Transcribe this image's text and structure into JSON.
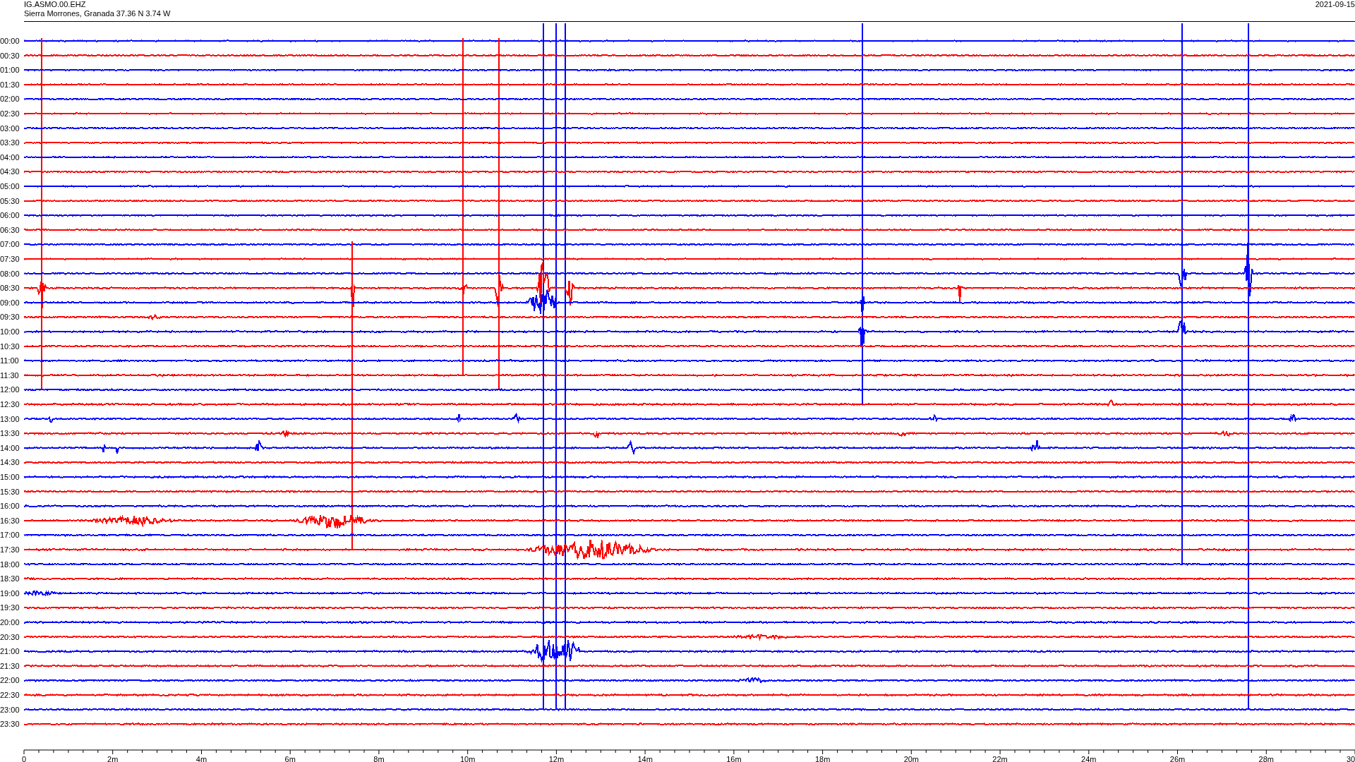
{
  "header": {
    "station": "IG.ASMO.00.EHZ",
    "location": "Sierra Morrones, Granada  37.36 N 3.74 W",
    "date": "2021-09-15"
  },
  "rows": [
    {
      "time": "00:00",
      "color": "#0000ff"
    },
    {
      "time": "00:30",
      "color": "#ff0000"
    },
    {
      "time": "01:00",
      "color": "#0000ff"
    },
    {
      "time": "01:30",
      "color": "#ff0000"
    },
    {
      "time": "02:00",
      "color": "#0000ff"
    },
    {
      "time": "02:30",
      "color": "#ff0000"
    },
    {
      "time": "03:00",
      "color": "#0000ff"
    },
    {
      "time": "03:30",
      "color": "#ff0000"
    },
    {
      "time": "04:00",
      "color": "#0000ff"
    },
    {
      "time": "04:30",
      "color": "#ff0000"
    },
    {
      "time": "05:00",
      "color": "#0000ff"
    },
    {
      "time": "05:30",
      "color": "#ff0000"
    },
    {
      "time": "06:00",
      "color": "#0000ff"
    },
    {
      "time": "06:30",
      "color": "#ff0000"
    },
    {
      "time": "07:00",
      "color": "#0000ff"
    },
    {
      "time": "07:30",
      "color": "#ff0000"
    },
    {
      "time": "08:00",
      "color": "#0000ff"
    },
    {
      "time": "08:30",
      "color": "#ff0000"
    },
    {
      "time": "09:00",
      "color": "#0000ff"
    },
    {
      "time": "09:30",
      "color": "#ff0000"
    },
    {
      "time": "10:00",
      "color": "#0000ff"
    },
    {
      "time": "10:30",
      "color": "#ff0000"
    },
    {
      "time": "11:00",
      "color": "#0000ff"
    },
    {
      "time": "11:30",
      "color": "#ff0000"
    },
    {
      "time": "12:00",
      "color": "#0000ff"
    },
    {
      "time": "12:30",
      "color": "#ff0000"
    },
    {
      "time": "13:00",
      "color": "#0000ff"
    },
    {
      "time": "13:30",
      "color": "#ff0000"
    },
    {
      "time": "14:00",
      "color": "#0000ff"
    },
    {
      "time": "14:30",
      "color": "#ff0000"
    },
    {
      "time": "15:00",
      "color": "#0000ff"
    },
    {
      "time": "15:30",
      "color": "#ff0000"
    },
    {
      "time": "16:00",
      "color": "#0000ff"
    },
    {
      "time": "16:30",
      "color": "#ff0000"
    },
    {
      "time": "17:00",
      "color": "#0000ff"
    },
    {
      "time": "17:30",
      "color": "#ff0000"
    },
    {
      "time": "18:00",
      "color": "#0000ff"
    },
    {
      "time": "18:30",
      "color": "#ff0000"
    },
    {
      "time": "19:00",
      "color": "#0000ff"
    },
    {
      "time": "19:30",
      "color": "#ff0000"
    },
    {
      "time": "20:00",
      "color": "#0000ff"
    },
    {
      "time": "20:30",
      "color": "#ff0000"
    },
    {
      "time": "21:00",
      "color": "#0000ff"
    },
    {
      "time": "21:30",
      "color": "#ff0000"
    },
    {
      "time": "22:00",
      "color": "#0000ff"
    },
    {
      "time": "22:30",
      "color": "#ff0000"
    },
    {
      "time": "23:00",
      "color": "#0000ff"
    },
    {
      "time": "23:30",
      "color": "#ff0000"
    }
  ],
  "axis": {
    "labels": [
      "0",
      "2m",
      "4m",
      "6m",
      "8m",
      "10m",
      "12m",
      "14m",
      "16m",
      "18m",
      "20m",
      "22m",
      "24m",
      "26m",
      "28m",
      "30"
    ]
  }
}
